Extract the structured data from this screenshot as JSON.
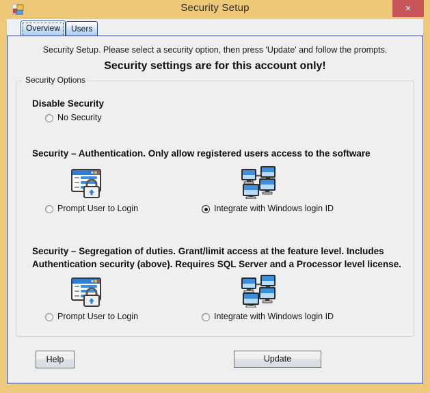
{
  "window": {
    "title": "Security Setup",
    "app_icon": "app-window-icon",
    "close_label": "×"
  },
  "tabs": [
    {
      "label": "Overview",
      "selected": true
    },
    {
      "label": "Users",
      "selected": false
    }
  ],
  "content": {
    "intro": "Security Setup.  Please select a security option, then press 'Update' and follow the prompts.",
    "headline": "Security settings are for this account only!",
    "group_title": "Security Options"
  },
  "sections": [
    {
      "heading": "Disable Security",
      "options": [
        {
          "label": "No Security",
          "selected": false
        }
      ]
    },
    {
      "heading": "Security – Authentication.  Only allow registered users access to the software",
      "options": [
        {
          "label": "Prompt User to Login",
          "selected": false,
          "icon": "login-dialog-lock-icon"
        },
        {
          "label": "Integrate with Windows login ID",
          "selected": true,
          "icon": "network-computers-icon"
        }
      ]
    },
    {
      "heading_line1": "Security – Segregation of duties. Grant/limit access at the feature level.  Includes",
      "heading_line2": "Authentication security (above). Requires SQL Server and a Processor level license.",
      "options": [
        {
          "label": "Prompt User to Login",
          "selected": false,
          "icon": "login-dialog-lock-icon"
        },
        {
          "label": "Integrate with Windows login ID",
          "selected": false,
          "icon": "network-computers-icon"
        }
      ]
    }
  ],
  "buttons": {
    "help": "Help",
    "update": "Update"
  },
  "colors": {
    "window_frame": "#eec97c",
    "close_button": "#c9545a",
    "panel_border": "#2c3e8f",
    "panel_bg": "#efeff0",
    "tab_blue": "#a9cdf2"
  }
}
